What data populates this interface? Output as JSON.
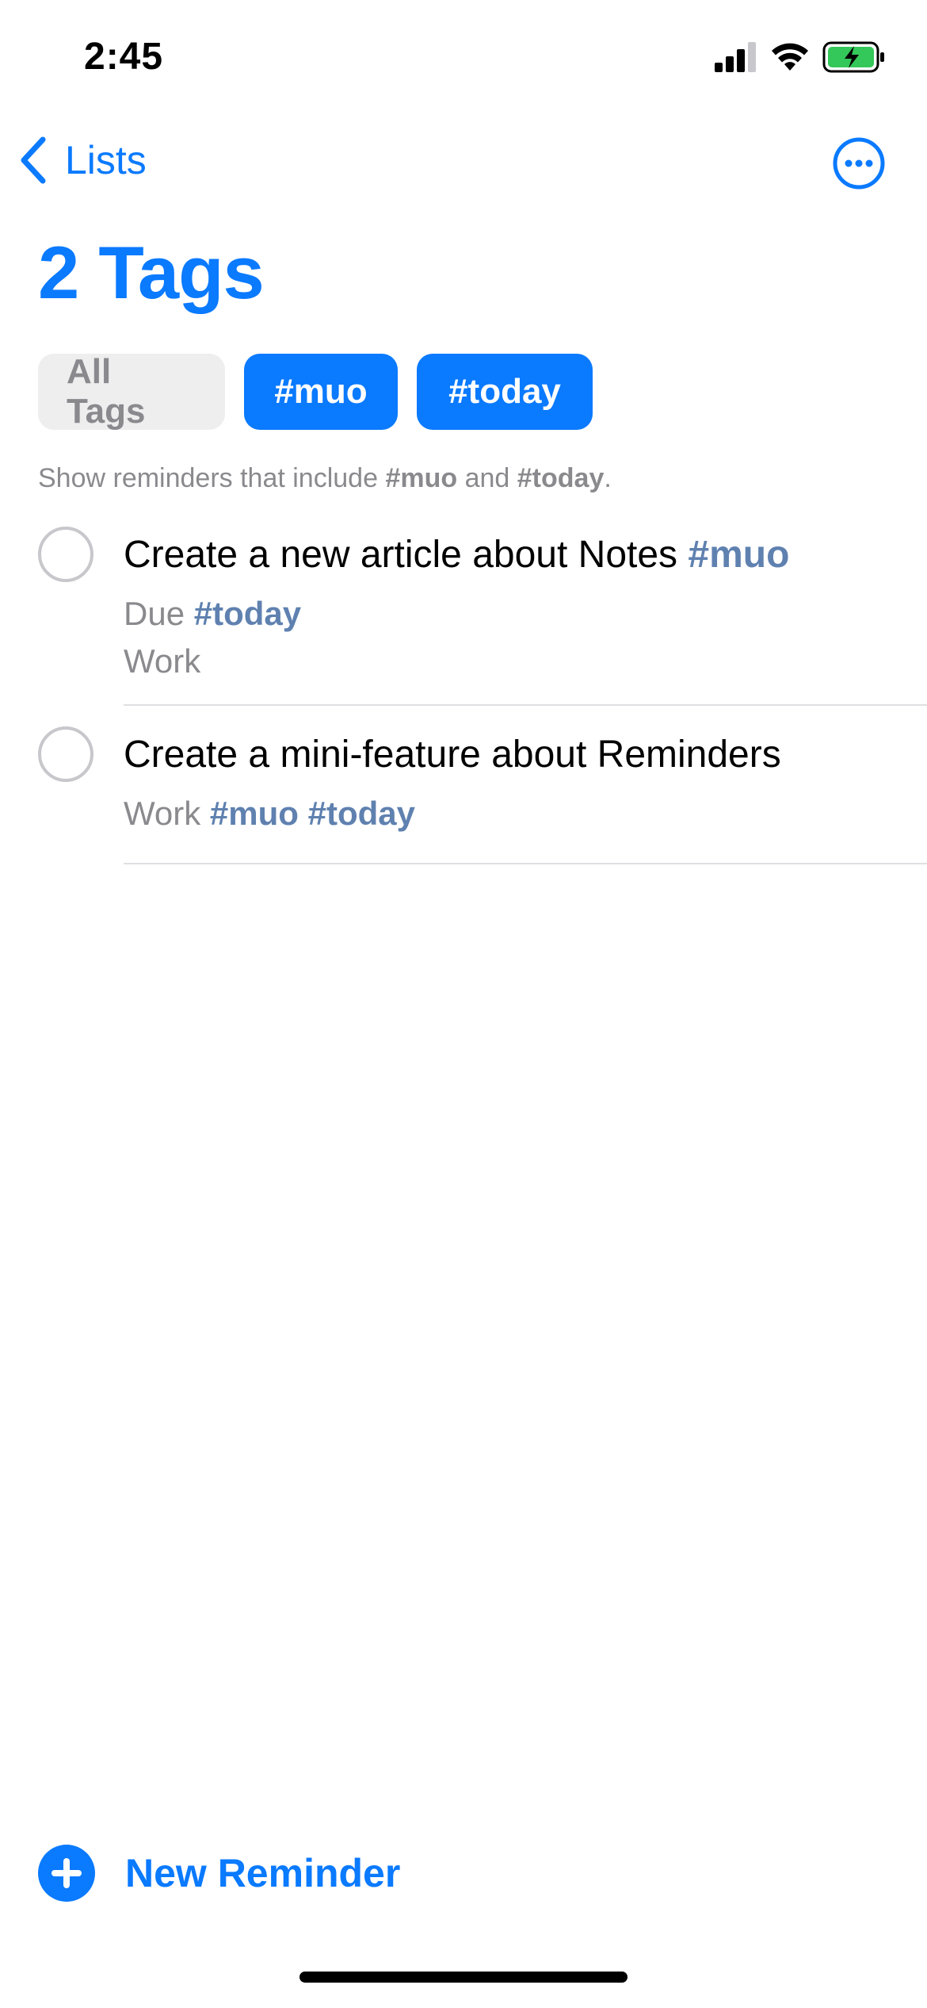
{
  "status_bar": {
    "time": "2:45",
    "icons": [
      "signal-icon",
      "wifi-icon",
      "battery-charging-icon"
    ]
  },
  "nav": {
    "back_label": "Lists",
    "more_icon": "ellipsis-circle-icon"
  },
  "title": "2 Tags",
  "tags": {
    "all_label": "All Tags",
    "selected": [
      "#muo",
      "#today"
    ]
  },
  "filter_description": {
    "prefix": "Show reminders that include ",
    "tag1": "#muo",
    "middle": " and ",
    "tag2": "#today",
    "suffix": "."
  },
  "reminders": [
    {
      "title": "Create a new article about Notes",
      "title_tag": "#muo",
      "due_prefix": "Due",
      "due_tag": "#today",
      "list": "Work"
    },
    {
      "title": "Create a mini-feature about Reminders",
      "list": "Work",
      "tag1": "#muo",
      "tag2": "#today"
    }
  ],
  "footer": {
    "new_reminder_label": "New Reminder"
  },
  "colors": {
    "accent": "#0a7aff",
    "tag_text": "#5f81b0",
    "secondary_text": "#8a8a8e",
    "chip_bg": "#eeeeef",
    "battery_fill": "#34c759"
  }
}
